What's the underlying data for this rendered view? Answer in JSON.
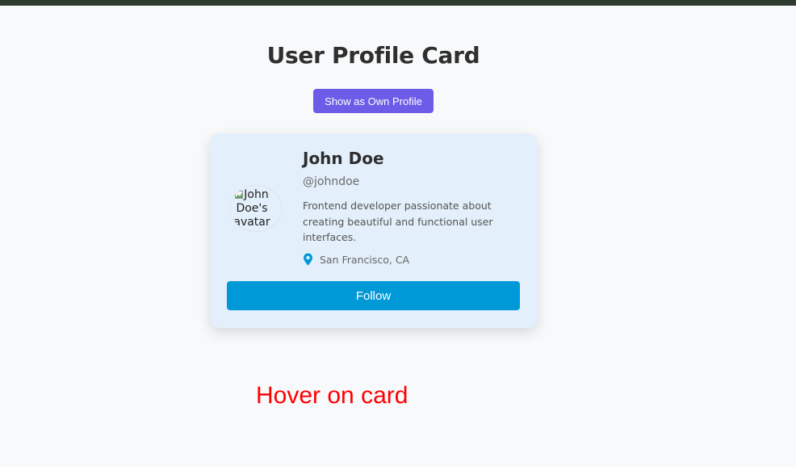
{
  "page": {
    "title": "User Profile Card",
    "toggle_button_label": "Show as Own Profile"
  },
  "profile": {
    "name": "John Doe",
    "username": "@johndoe",
    "bio": "Frontend developer passionate about creating beautiful and functional user interfaces.",
    "location": "San Francisco, CA",
    "avatar_alt": "John Doe's avatar",
    "follow_label": "Follow"
  },
  "annotation": {
    "text": "Hover on card"
  },
  "colors": {
    "accent_purple": "#6c5ce7",
    "follow_blue": "#0099d8",
    "card_bg": "#e3effa",
    "location_pin": "#0099d8",
    "annotation_red": "#ff0000"
  },
  "icons": {
    "location": "map-pin-icon",
    "avatar_broken": "broken-image-icon"
  }
}
